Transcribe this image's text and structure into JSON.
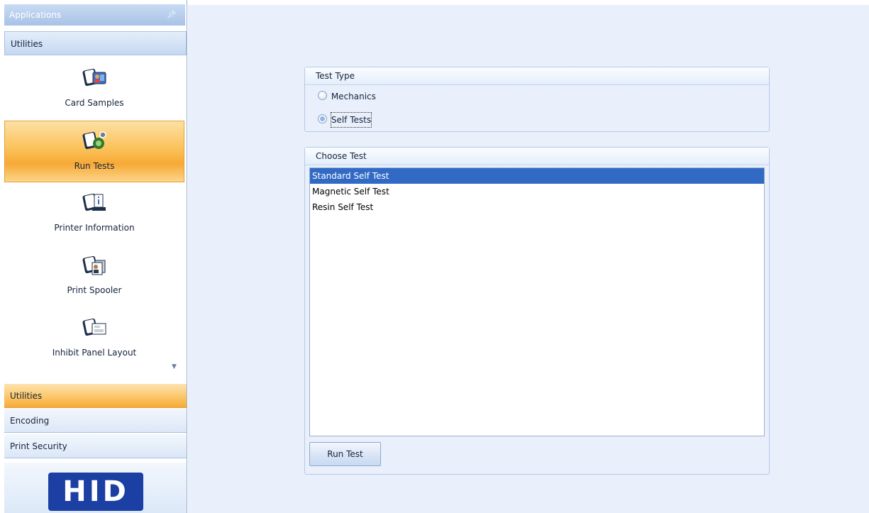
{
  "nav": {
    "title": "Applications",
    "pin_glyph": "↕",
    "group_header": "Utilities",
    "items": [
      {
        "label": "Card Samples",
        "icon": "card-samples-icon",
        "selected": false
      },
      {
        "label": "Run Tests",
        "icon": "run-tests-icon",
        "selected": true
      },
      {
        "label": "Printer Information",
        "icon": "printer-information-icon",
        "selected": false
      },
      {
        "label": "Print Spooler",
        "icon": "print-spooler-icon",
        "selected": false
      },
      {
        "label": "Inhibit Panel Layout",
        "icon": "inhibit-panel-layout-icon",
        "selected": false
      }
    ],
    "sections": [
      {
        "label": "Utilities",
        "active": true
      },
      {
        "label": "Encoding",
        "active": false
      },
      {
        "label": "Print Security",
        "active": false
      }
    ],
    "logo_text": "HID"
  },
  "test_type": {
    "header": "Test Type",
    "options": [
      {
        "label": "Mechanics",
        "checked": false
      },
      {
        "label": "Self Tests",
        "checked": true
      }
    ]
  },
  "choose_test": {
    "header": "Choose Test",
    "items": [
      {
        "label": "Standard Self Test",
        "selected": true
      },
      {
        "label": "Magnetic Self Test",
        "selected": false
      },
      {
        "label": "Resin Self Test",
        "selected": false
      }
    ],
    "run_button": "Run Test"
  },
  "colors": {
    "selected_nav": "#fbc25a",
    "list_selection": "#316ac5",
    "main_background": "#e9f0fb",
    "logo_blue": "#1b3fa3"
  }
}
